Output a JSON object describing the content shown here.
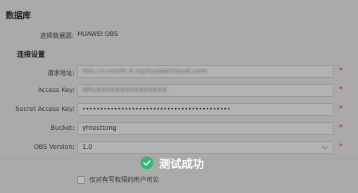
{
  "section_title": "数据库",
  "datasource": {
    "label": "选择数据源:",
    "value": "HUAWEI OBS"
  },
  "connection_title": "连接设置",
  "fields": {
    "endpoint": {
      "label": "请求地址:",
      "value": "obs.cn-north-4.myhuaweicloud.com"
    },
    "access_key": {
      "label": "Access Key:",
      "value": "HPUAXXXXXXXXXXXXXX"
    },
    "secret_key": {
      "label": "Secret Access Key:",
      "value": "••••••••••••••••••••••••••••••••••••••••••"
    },
    "bucket": {
      "label": "Bucket:",
      "value": "yhtesttong"
    },
    "obs_version": {
      "label": "OBS Version:",
      "value": "1.0"
    }
  },
  "required_mark": "*",
  "visibility_checkbox": {
    "label": "仅对有写权限的用户可见",
    "checked": false
  },
  "toast": {
    "text": "测试成功",
    "color": "#2dbb6e"
  },
  "icons": {
    "success": "check-circle-icon",
    "dropdown": "chevron-down-icon"
  }
}
